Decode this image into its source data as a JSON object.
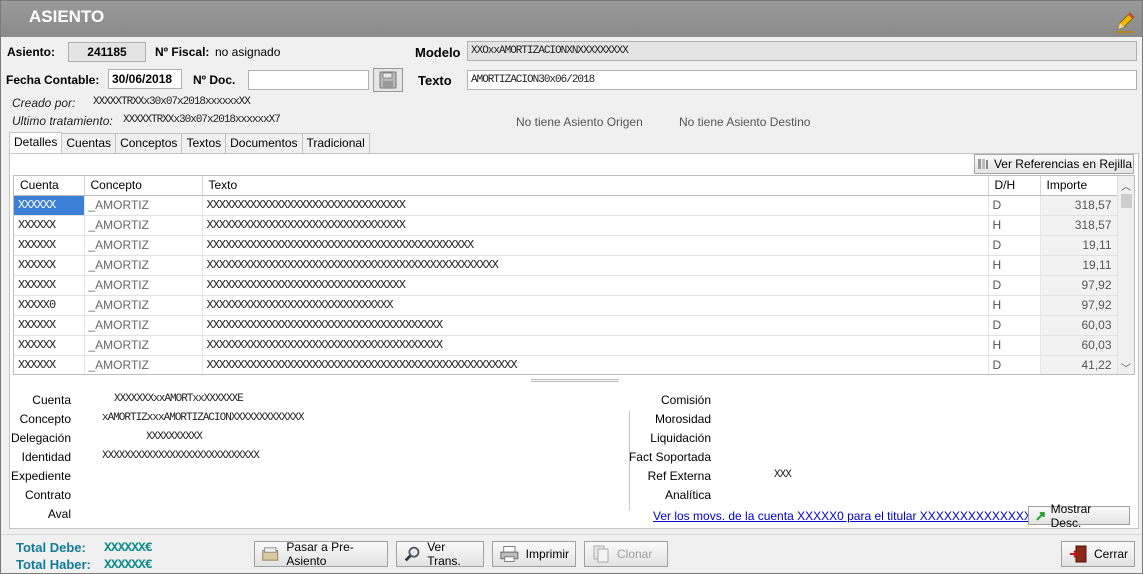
{
  "window": {
    "title": "ASIENTO"
  },
  "header": {
    "asiento_label": "Asiento:",
    "asiento_value": "241185",
    "fiscal_label": "Nº Fiscal:",
    "fiscal_value": "no asignado",
    "modelo_label": "Modelo",
    "modelo_value": "XXOxxAMORTIZACIONXNXXXXXXXXX",
    "fecha_label": "Fecha Contable:",
    "fecha_value": "30/06/2018",
    "doc_label": "Nº Doc.",
    "doc_value": "",
    "texto_label": "Texto",
    "texto_value": "AMORTIZACION30x06/2018",
    "creado_label": "Creado por:",
    "creado_value": "XXXXXTRXXx30x07x2018xxxxxxXX",
    "tratamiento_label": "Ultimo tratamiento:",
    "tratamiento_value": "XXXXXTRXXx30x07x2018xxxxxxX7",
    "origen_text": "No tiene Asiento Origen",
    "destino_text": "No tiene Asiento Destino"
  },
  "tabs": [
    {
      "label": "Detalles",
      "active": true
    },
    {
      "label": "Cuentas",
      "active": false
    },
    {
      "label": "Conceptos",
      "active": false
    },
    {
      "label": "Textos",
      "active": false
    },
    {
      "label": "Documentos",
      "active": false
    },
    {
      "label": "Tradicional",
      "active": false
    }
  ],
  "ref_button": {
    "label": "Ver Referencias en Rejilla",
    "icon": "book-icon"
  },
  "grid": {
    "columns": [
      "Cuenta",
      "Concepto",
      "Texto",
      "D/H",
      "Importe"
    ],
    "rows": [
      {
        "cuenta": "XXXXXX",
        "concepto": "_AMORTIZ",
        "texto": "XXXXXXXXXXXXXXXXXXXXXXXXXXXXXXXX",
        "dh": "D",
        "importe": "318,57"
      },
      {
        "cuenta": "XXXXXX",
        "concepto": "_AMORTIZ",
        "texto": "XXXXXXXXXXXXXXXXXXXXXXXXXXXXXXXX",
        "dh": "H",
        "importe": "318,57"
      },
      {
        "cuenta": "XXXXXX",
        "concepto": "_AMORTIZ",
        "texto": "XXXXXXXXXXXXXXXXXXXXXXXXXXXXXXXXXXXXXXXXXXX",
        "dh": "D",
        "importe": "19,11"
      },
      {
        "cuenta": "XXXXXX",
        "concepto": "_AMORTIZ",
        "texto": "XXXXXXXXXXXXXXXXXXXXXXXXXXXXXXXXXXXXXXXXXXXXXXX",
        "dh": "H",
        "importe": "19,11"
      },
      {
        "cuenta": "XXXXXX",
        "concepto": "_AMORTIZ",
        "texto": "XXXXXXXXXXXXXXXXXXXXXXXXXXXXXXXX",
        "dh": "D",
        "importe": "97,92"
      },
      {
        "cuenta": "XXXXX0",
        "concepto": "_AMORTIZ",
        "texto": "XXXXXXXXXXXXXXXXXXXXXXXXXXXXXX",
        "dh": "H",
        "importe": "97,92"
      },
      {
        "cuenta": "XXXXXX",
        "concepto": "_AMORTIZ",
        "texto": "XXXXXXXXXXXXXXXXXXXXXXXXXXXXXXXXXXXXXX",
        "dh": "D",
        "importe": "60,03"
      },
      {
        "cuenta": "XXXXXX",
        "concepto": "_AMORTIZ",
        "texto": "XXXXXXXXXXXXXXXXXXXXXXXXXXXXXXXXXXXXXX",
        "dh": "H",
        "importe": "60,03"
      },
      {
        "cuenta": "XXXXXX",
        "concepto": "_AMORTIZ",
        "texto": "XXXXXXXXXXXXXXXXXXXXXXXXXXXXXXXXXXXXXXXXXXXXXXXXXX",
        "dh": "D",
        "importe": "41,22"
      }
    ]
  },
  "details_left": {
    "cuenta_label": "Cuenta",
    "cuenta_value": "XXXXXXXxxAMORTxxXXXXXXE",
    "concepto_label": "Concepto",
    "concepto_value": "xAMORTIZxxxAMORTIZACIONXXXXXXXXXXXXX",
    "delegacion_label": "Delegación",
    "delegacion_value": "XXXXXXXXXX",
    "identidad_label": "Identidad",
    "identidad_value": "XXXXXXXXXXXXXXXXXXXXXXXXXXXX",
    "expediente_label": "Expediente",
    "contrato_label": "Contrato",
    "aval_label": "Aval"
  },
  "details_right": {
    "comision_label": "Comisión",
    "morosidad_label": "Morosidad",
    "liquidacion_label": "Liquidación",
    "fact_label": "Fact Soportada",
    "ref_label": "Ref Externa",
    "ref_value": "XXX",
    "analitica_label": "Analítica"
  },
  "movs_link": "Ver los movs. de la cuenta XXXXX0 para el titular XXXXXXXXXXXXXX",
  "mostrar_button": {
    "label": "Mostrar Desc.",
    "icon": "arrow-icon"
  },
  "totals": {
    "debe_label": "Total Debe:",
    "debe_value": "XXXXXX€",
    "haber_label": "Total Haber:",
    "haber_value": "XXXXXX€"
  },
  "buttons": {
    "pre_asiento": "Pasar a Pre-Asiento",
    "ver_trans": "Ver Trans.",
    "imprimir": "Imprimir",
    "clonar": "Clonar",
    "cerrar": "Cerrar"
  }
}
